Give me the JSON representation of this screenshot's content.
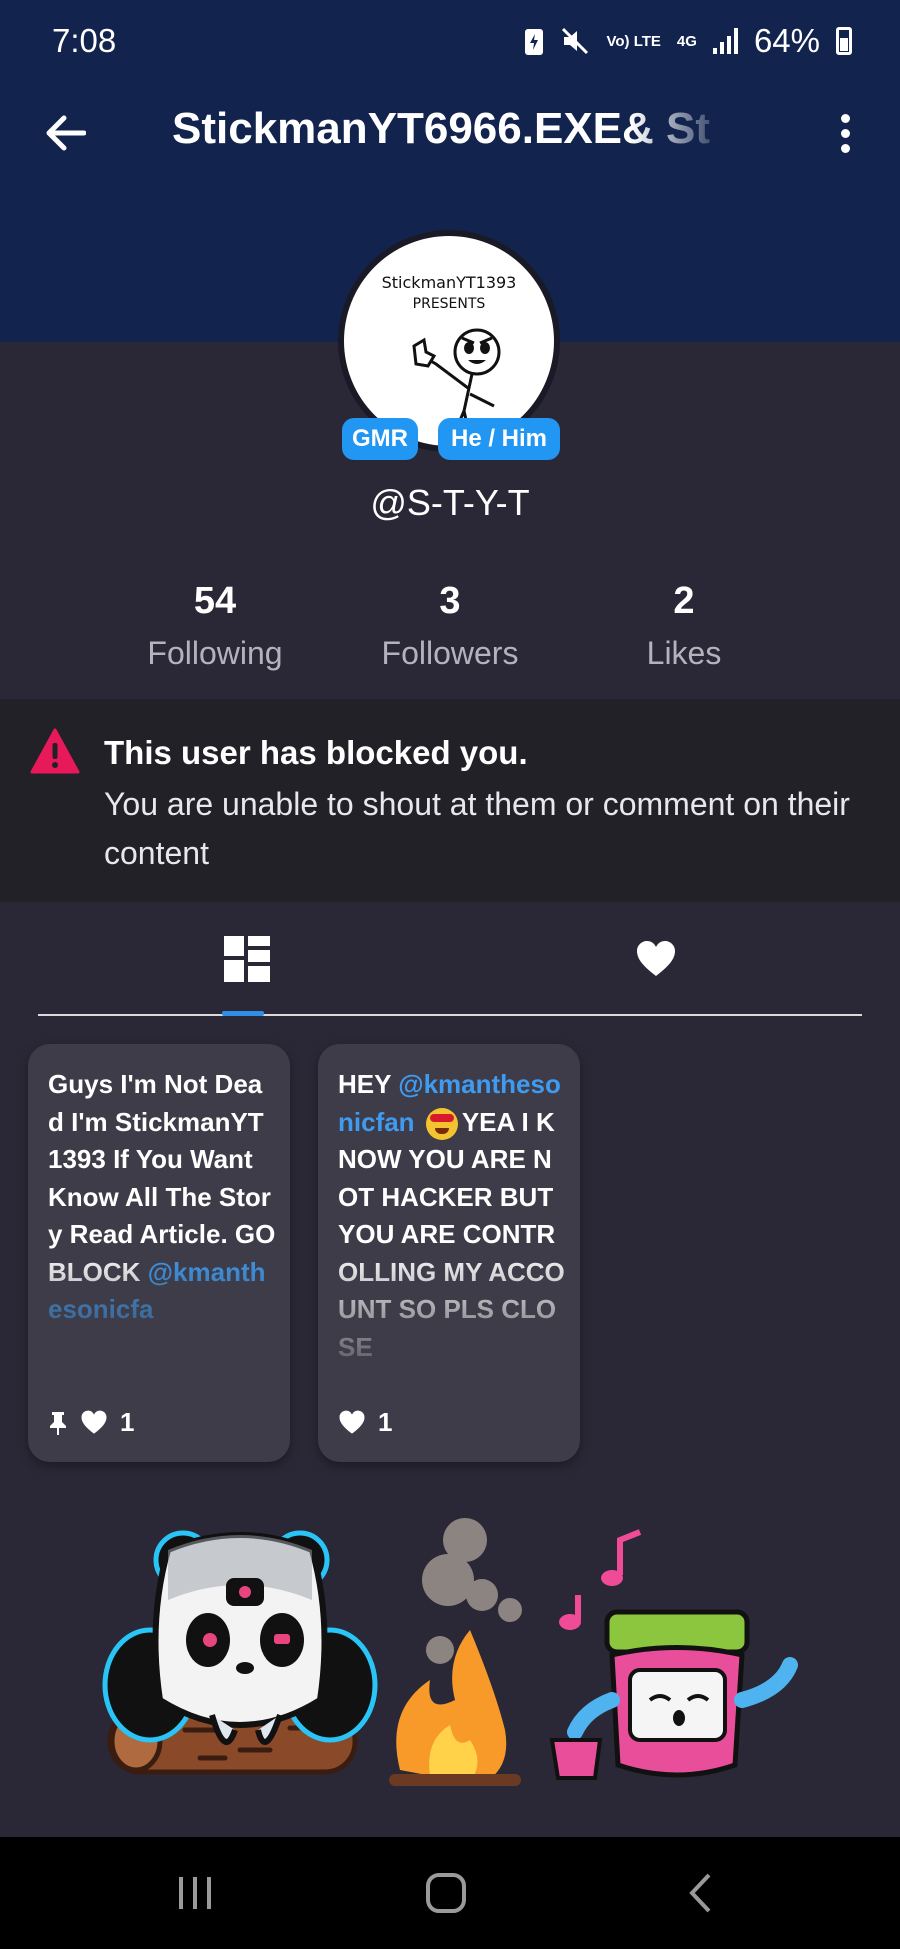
{
  "status_bar": {
    "time": "7:08",
    "network_type": "Vo) LTE",
    "network_gen": "4G",
    "battery": "64%"
  },
  "app_bar": {
    "title": "StickmanYT6966.EXE& St",
    "back_icon": "arrow-left-icon",
    "menu_icon": "more-vertical-icon"
  },
  "profile": {
    "avatar_text_line1": "StickmanYT1393",
    "avatar_text_line2": "PRESENTS",
    "role_badge": "GMR",
    "pronoun_badge": "He / Him",
    "handle": "@S-T-Y-T"
  },
  "stats": [
    {
      "value": "54",
      "label": "Following"
    },
    {
      "value": "3",
      "label": "Followers"
    },
    {
      "value": "2",
      "label": "Likes"
    }
  ],
  "blocked_notice": {
    "title": "This user has blocked you.",
    "body": "You are unable to shout at them or comment on their content",
    "icon": "warning-icon",
    "accent": "#e8195a"
  },
  "tabs": [
    {
      "icon": "grid-icon",
      "selected": true
    },
    {
      "icon": "heart-icon",
      "selected": false
    }
  ],
  "posts": [
    {
      "text": "Guys I'm Not Dead I'm StickmanYT1393 If You Want Know All The Story Read Article. GO BLOCK",
      "mention_tail": "@kmanthesonicfa",
      "pinned": true,
      "likes": "1"
    },
    {
      "text_before": "HEY",
      "mention": "@kmanthesonicfan",
      "text_after": "YEA I KNOW YOU ARE NOT HACKER BUT YOU ARE CONTROLLING MY ACCOUNT SO PLS CLOSE",
      "pinned": false,
      "likes": "1"
    }
  ],
  "colors": {
    "header": "#12244d",
    "background": "#2a2836",
    "card": "#3d3c48",
    "accent_blue": "#2196f3"
  }
}
